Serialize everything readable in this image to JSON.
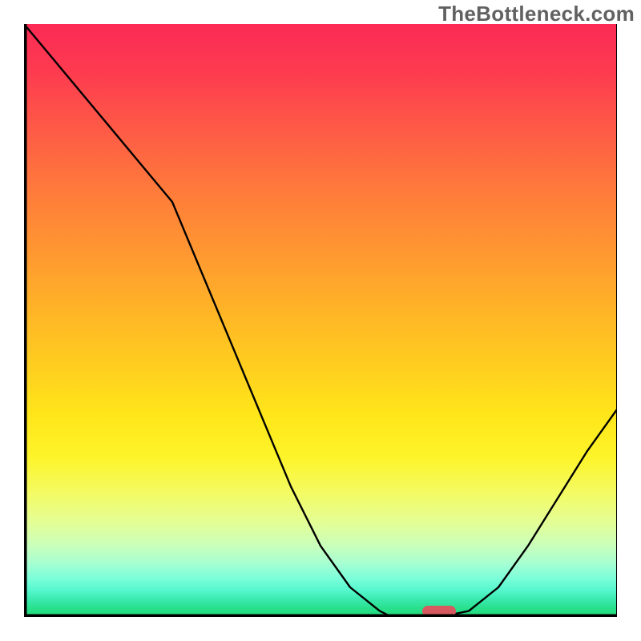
{
  "watermark": "TheBottleneck.com",
  "marker": {
    "x_frac": 0.7,
    "y_frac": 0.991
  },
  "colors": {
    "curve": "#000000",
    "axis": "#000000",
    "marker": "#d65a5f",
    "watermark": "#616161"
  },
  "chart_data": {
    "type": "line",
    "title": "",
    "xlabel": "",
    "ylabel": "",
    "xlim": [
      0,
      100
    ],
    "ylim": [
      0,
      100
    ],
    "series": [
      {
        "name": "bottleneck-curve",
        "x": [
          0,
          5,
          10,
          15,
          20,
          25,
          30,
          35,
          40,
          45,
          50,
          55,
          60,
          62,
          65,
          70,
          75,
          80,
          85,
          90,
          95,
          100
        ],
        "y": [
          100,
          94,
          88,
          82,
          76,
          70,
          58,
          46,
          34,
          22,
          12,
          5,
          1,
          0,
          0,
          0,
          1,
          5,
          12,
          20,
          28,
          35
        ]
      }
    ],
    "annotations": [
      {
        "kind": "marker-pill",
        "x": 70,
        "y": 0.9,
        "color": "#d65a5f"
      }
    ],
    "background": {
      "gradient_stops": [
        {
          "pos": 0.0,
          "color": "#fc2a55"
        },
        {
          "pos": 0.28,
          "color": "#ff7a3b"
        },
        {
          "pos": 0.58,
          "color": "#ffcf1f"
        },
        {
          "pos": 0.79,
          "color": "#f4fb63"
        },
        {
          "pos": 0.91,
          "color": "#a6ffd2"
        },
        {
          "pos": 1.0,
          "color": "#22db78"
        }
      ]
    }
  }
}
